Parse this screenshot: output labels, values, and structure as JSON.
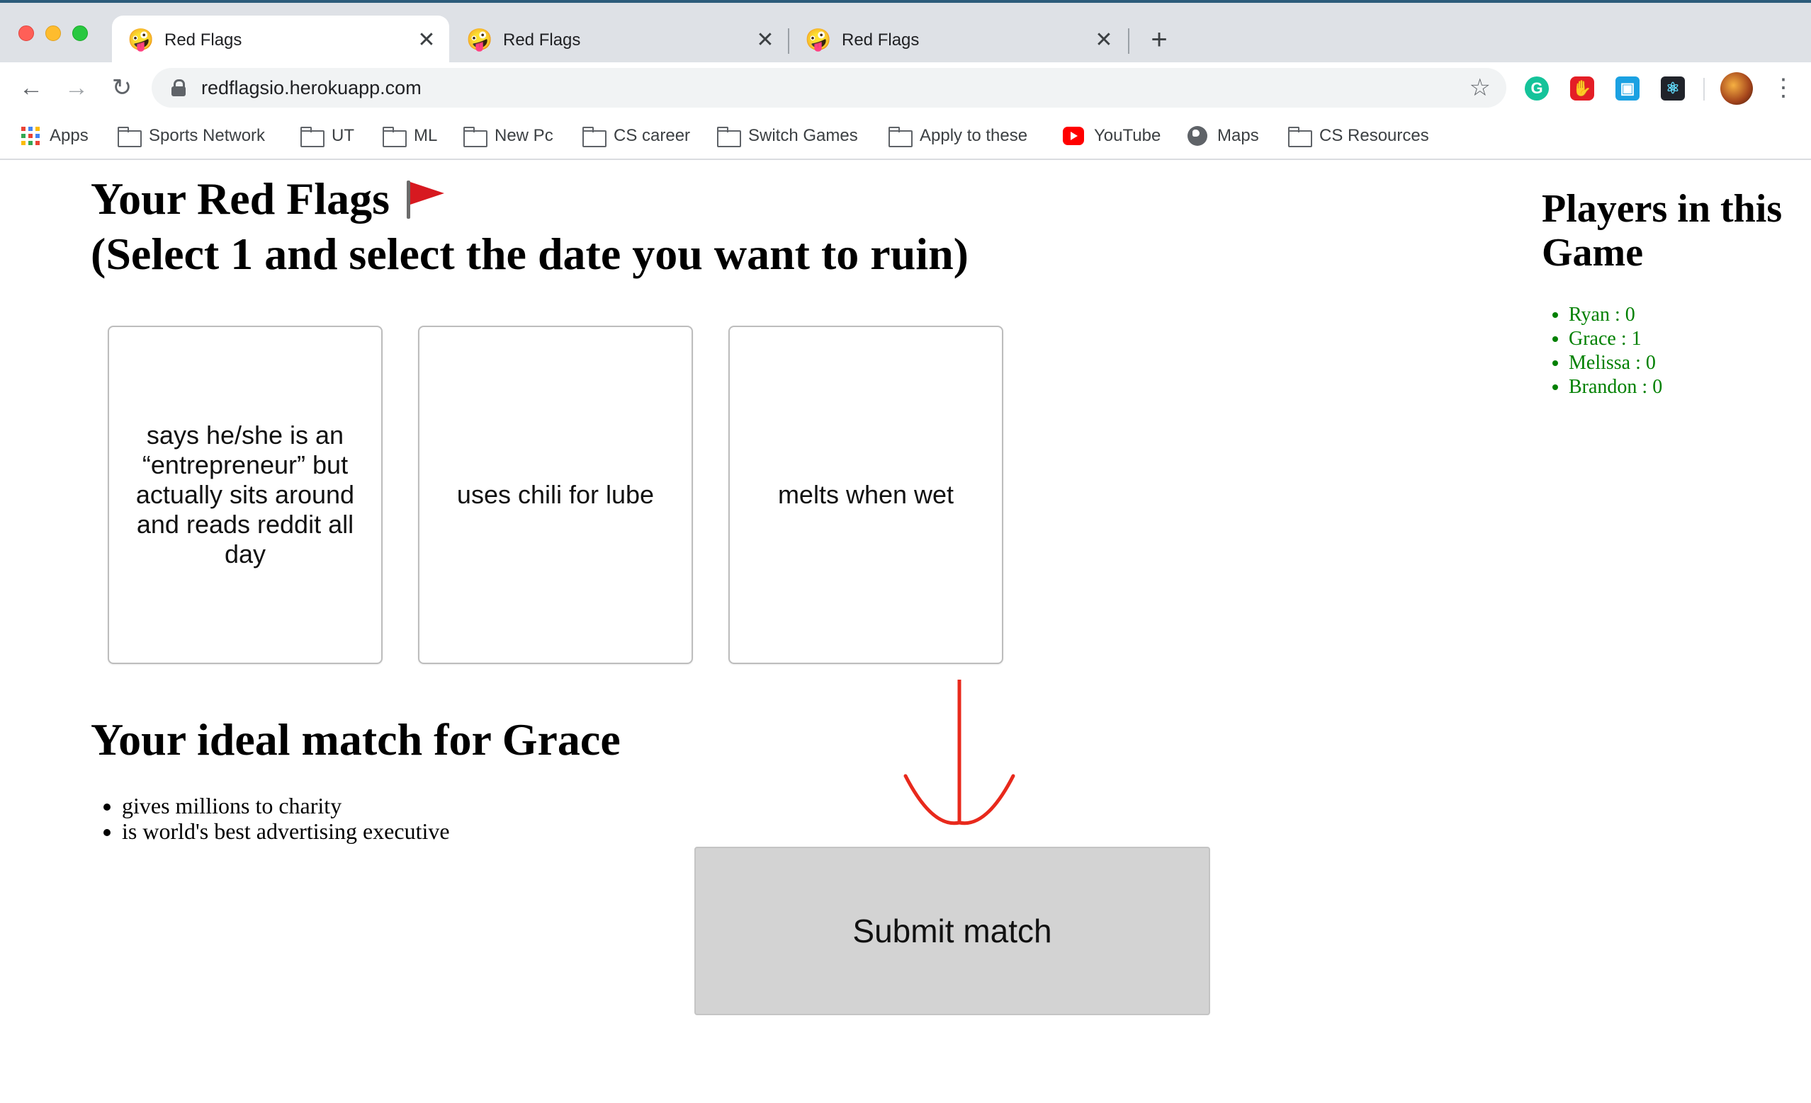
{
  "browser": {
    "tabs": [
      {
        "title": "Red Flags",
        "favicon": "🤪",
        "active": true
      },
      {
        "title": "Red Flags",
        "favicon": "🤪",
        "active": false
      },
      {
        "title": "Red Flags",
        "favicon": "🤪",
        "active": false
      }
    ],
    "close_glyph": "✕",
    "new_tab_glyph": "+",
    "back_glyph": "←",
    "forward_glyph": "→",
    "reload_glyph": "↻",
    "url": "redflagsio.herokuapp.com",
    "star_glyph": "☆",
    "menu_glyph": "⋮",
    "extensions": [
      "grammarly-icon",
      "adblock-icon",
      "window-resizer-icon",
      "react-devtools-icon"
    ],
    "extension_glyphs": {
      "grammarly": "G",
      "adblock": "✋",
      "window": "▣",
      "react": "⚛"
    },
    "bookmarks": [
      {
        "label": "Apps",
        "icon": "apps-grid-icon"
      },
      {
        "label": "Sports Network",
        "icon": "folder-icon"
      },
      {
        "label": "UT",
        "icon": "folder-icon"
      },
      {
        "label": "ML",
        "icon": "folder-icon"
      },
      {
        "label": "New Pc",
        "icon": "folder-icon"
      },
      {
        "label": "CS career",
        "icon": "folder-icon"
      },
      {
        "label": "Switch Games",
        "icon": "folder-icon"
      },
      {
        "label": "Apply to these",
        "icon": "folder-icon"
      },
      {
        "label": "YouTube",
        "icon": "youtube-icon"
      },
      {
        "label": "Maps",
        "icon": "globe-icon"
      },
      {
        "label": "CS Resources",
        "icon": "folder-icon"
      }
    ]
  },
  "game": {
    "flags_heading_line1": "Your Red Flags",
    "flags_heading_line2": "(Select 1 and select the date you want to ruin)",
    "cards": [
      "says he/she is an “entrepreneur” but actually sits around and reads reddit all day",
      "uses chili for lube",
      "melts when wet"
    ],
    "match_heading": "Your ideal match for Grace",
    "match_traits": [
      "gives millions to charity",
      "is world's best advertising executive"
    ],
    "submit_label": "Submit match",
    "players_heading": "Players in this Game",
    "players": [
      "Ryan : 0",
      "Grace : 1",
      "Melissa : 0",
      "Brandon : 0"
    ]
  },
  "colors": {
    "annotation_arrow": "#e8291c",
    "player_text": "#008000",
    "submit_bg": "#d3d3d3",
    "flag_red": "#d71920"
  }
}
